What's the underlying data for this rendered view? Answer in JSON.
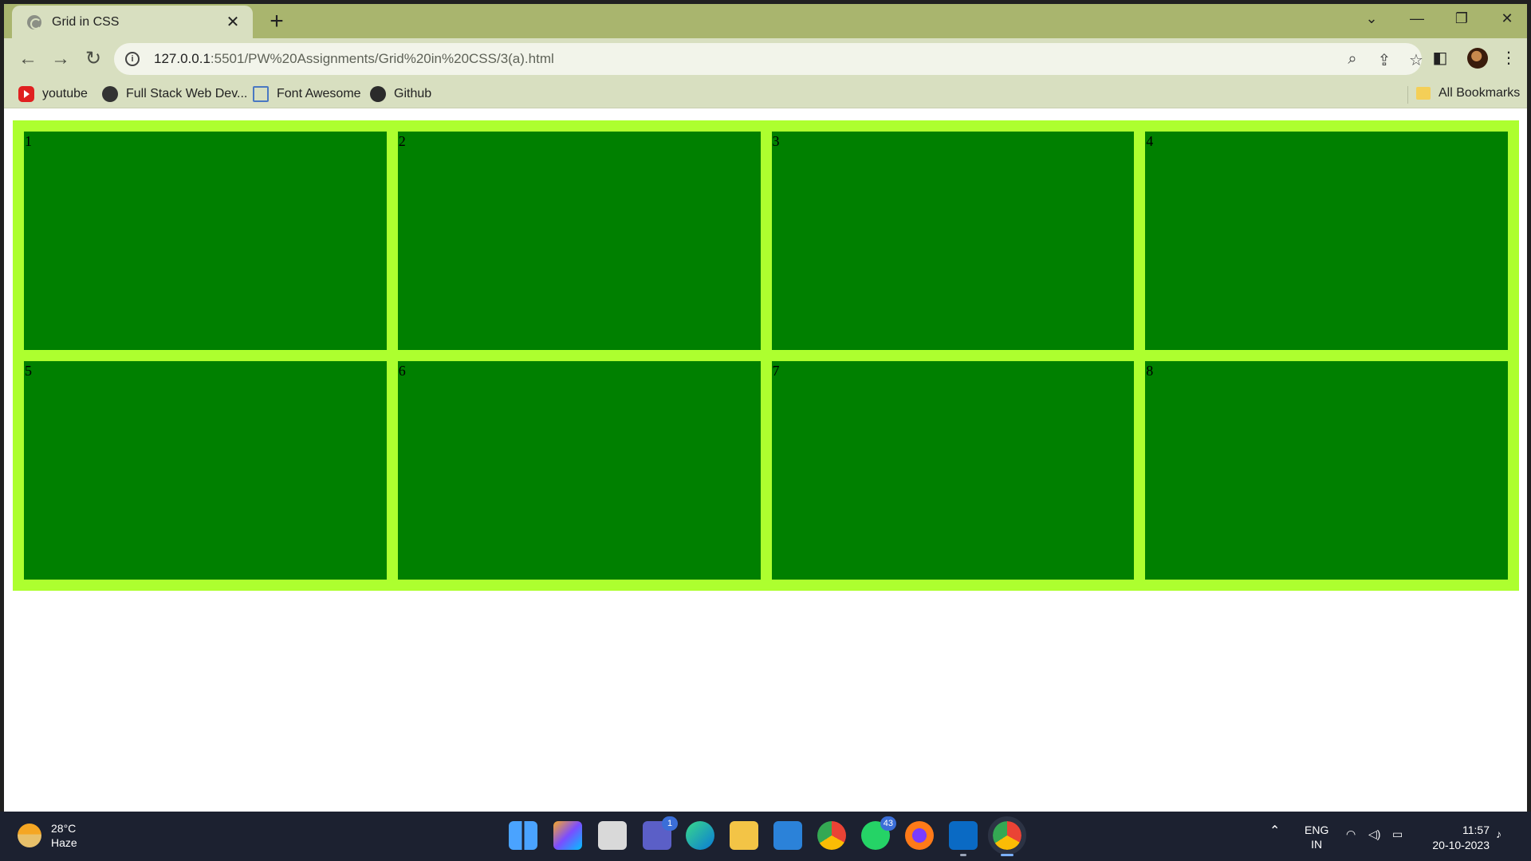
{
  "browser": {
    "tab_title": "Grid in CSS",
    "tab_close": "✕",
    "new_tab": "+",
    "window_controls": {
      "chevron": "⌄",
      "minimize": "—",
      "restore": "❐",
      "close": "✕"
    },
    "url_host": "127.0.0.1",
    "url_rest": ":5501/PW%20Assignments/Grid%20in%20CSS/3(a).html",
    "bookmarks": [
      {
        "label": "youtube",
        "icon": "youtube-icon"
      },
      {
        "label": "Full Stack Web Dev...",
        "icon": "site-icon"
      },
      {
        "label": "Font Awesome",
        "icon": "flag-icon"
      },
      {
        "label": "Github",
        "icon": "github-icon"
      }
    ],
    "all_bookmarks": "All Bookmarks"
  },
  "page": {
    "cells": [
      "1",
      "2",
      "3",
      "4",
      "5",
      "6",
      "7",
      "8"
    ],
    "colors": {
      "container": "#adff2f",
      "item": "#008000"
    }
  },
  "taskbar": {
    "weather_temp": "28°C",
    "weather_desc": "Haze",
    "teams_badge": "1",
    "whatsapp_badge": "43",
    "lang": "ENG",
    "region": "IN",
    "time": "11:57",
    "date": "20-10-2023"
  }
}
